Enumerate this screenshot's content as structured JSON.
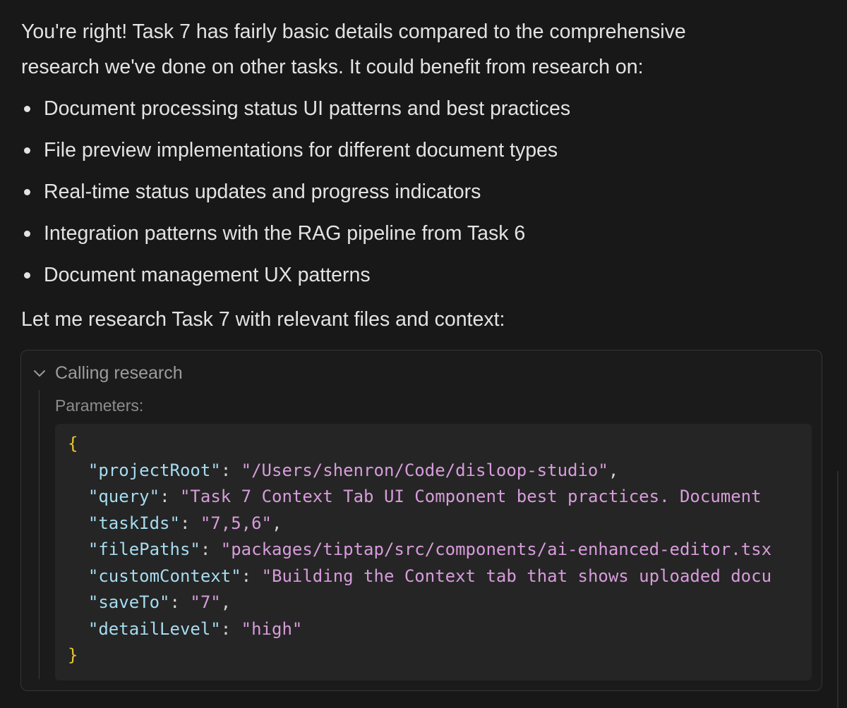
{
  "message": {
    "intro_line1": "You're right! Task 7 has fairly basic details compared to the comprehensive",
    "intro_line2": "research we've done on other tasks. It could benefit from research on:",
    "bullets": [
      "Document processing status UI patterns and best practices",
      "File preview implementations for different document types",
      "Real-time status updates and progress indicators",
      "Integration patterns with the RAG pipeline from Task 6",
      "Document management UX patterns"
    ],
    "lead": "Let me research Task 7 with relevant files and context:"
  },
  "tool_call": {
    "title": "Calling research",
    "expanded": true,
    "icon": "chevron-down-icon",
    "params_label": "Parameters:",
    "open_brace": "{",
    "close_brace": "}",
    "params": [
      {
        "key": "\"projectRoot\"",
        "value": "\"/Users/shenron/Code/disloop-studio\"",
        "trail": ","
      },
      {
        "key": "\"query\"",
        "value": "\"Task 7 Context Tab UI Component best practices. Document",
        "trail": ""
      },
      {
        "key": "\"taskIds\"",
        "value": "\"7,5,6\"",
        "trail": ","
      },
      {
        "key": "\"filePaths\"",
        "value": "\"packages/tiptap/src/components/ai-enhanced-editor.tsx",
        "trail": ""
      },
      {
        "key": "\"customContext\"",
        "value": "\"Building the Context tab that shows uploaded docu",
        "trail": ""
      },
      {
        "key": "\"saveTo\"",
        "value": "\"7\"",
        "trail": ","
      },
      {
        "key": "\"detailLevel\"",
        "value": "\"high\"",
        "trail": ""
      }
    ]
  },
  "colors": {
    "background": "#181818",
    "text": "#e3e3e3",
    "code_key": "#a6dcf0",
    "code_string": "#d79cdb",
    "code_brace": "#e9c62e"
  }
}
